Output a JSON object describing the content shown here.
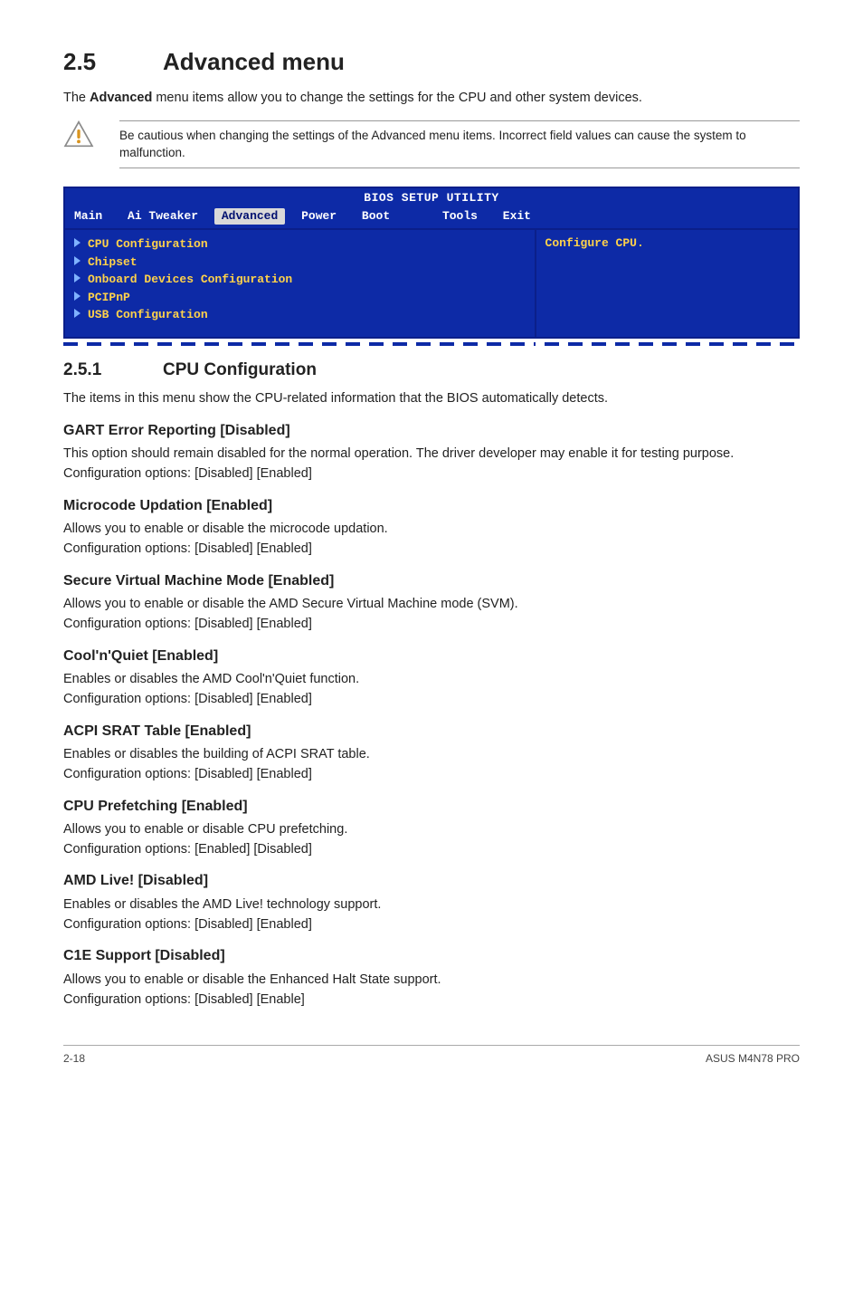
{
  "heading": {
    "number": "2.5",
    "title": "Advanced menu"
  },
  "intro_1": "The ",
  "intro_bold": "Advanced",
  "intro_2": " menu items allow you to change the settings for the CPU and other system devices.",
  "caution": "Be cautious when changing the settings of the Advanced menu items. Incorrect field values can cause the system to malfunction.",
  "bios": {
    "title": "BIOS SETUP UTILITY",
    "tabs": [
      "Main",
      "Ai Tweaker",
      "Advanced",
      "Power",
      "Boot",
      "Tools",
      "Exit"
    ],
    "active_tab": "Advanced",
    "left_items": [
      "CPU Configuration",
      "Chipset",
      "Onboard Devices Configuration",
      "PCIPnP",
      "USB Configuration"
    ],
    "right_text": "Configure CPU."
  },
  "subheading": {
    "number": "2.5.1",
    "title": "CPU Configuration"
  },
  "sub_intro": "The items in this menu show the CPU-related information that the BIOS automatically detects.",
  "sections": [
    {
      "title": "GART Error Reporting [Disabled]",
      "body": "This option should remain disabled for the normal operation. The driver developer may enable it for testing purpose.",
      "opts": "Configuration options: [Disabled] [Enabled]"
    },
    {
      "title": "Microcode Updation [Enabled]",
      "body": "Allows you to enable or disable the microcode updation.",
      "opts": "Configuration options: [Disabled] [Enabled]"
    },
    {
      "title": "Secure Virtual Machine Mode [Enabled]",
      "body": "Allows you to enable or disable the AMD Secure Virtual Machine mode (SVM).",
      "opts": "Configuration options: [Disabled] [Enabled]"
    },
    {
      "title": "Cool'n'Quiet [Enabled]",
      "body": "Enables or disables the AMD Cool'n'Quiet function.",
      "opts": "Configuration options: [Disabled] [Enabled]"
    },
    {
      "title": "ACPI SRAT Table [Enabled]",
      "body": "Enables or disables the building of ACPI SRAT table.",
      "opts": "Configuration options: [Disabled] [Enabled]"
    },
    {
      "title": "CPU Prefetching [Enabled]",
      "body": "Allows you to enable or disable CPU prefetching.",
      "opts": "Configuration options: [Enabled] [Disabled]"
    },
    {
      "title": "AMD Live! [Disabled]",
      "body": "Enables or disables the AMD Live! technology support.",
      "opts": "Configuration options: [Disabled] [Enabled]"
    },
    {
      "title": "C1E Support [Disabled]",
      "body": "Allows you to enable or disable the Enhanced Halt State support.",
      "opts": "Configuration options: [Disabled] [Enable]"
    }
  ],
  "footer": {
    "left": "2-18",
    "right": "ASUS M4N78 PRO"
  }
}
